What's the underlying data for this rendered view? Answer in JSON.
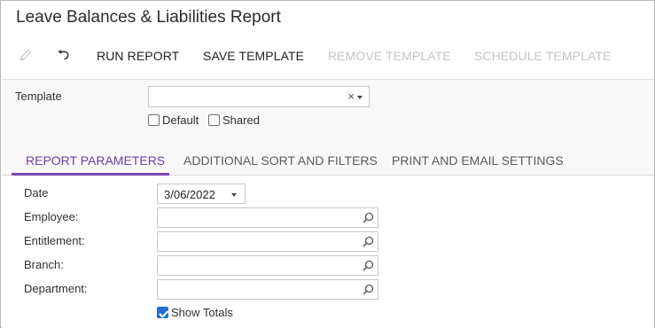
{
  "page": {
    "title": "Leave Balances & Liabilities Report"
  },
  "toolbar": {
    "edit_icon": "pencil-icon",
    "undo_icon": "undo-icon",
    "run_report": "RUN REPORT",
    "save_template": "SAVE TEMPLATE",
    "remove_template": "REMOVE TEMPLATE",
    "schedule_template": "SCHEDULE TEMPLATE"
  },
  "template": {
    "label": "Template",
    "value": "",
    "clear_glyph": "×",
    "default_label": "Default",
    "default_checked": false,
    "shared_label": "Shared",
    "shared_checked": false
  },
  "tabs": [
    {
      "label": "REPORT PARAMETERS",
      "active": true
    },
    {
      "label": "ADDITIONAL SORT AND FILTERS",
      "active": false
    },
    {
      "label": "PRINT AND EMAIL SETTINGS",
      "active": false
    }
  ],
  "parameters": {
    "date_label": "Date",
    "date_value": "3/06/2022",
    "employee_label": "Employee:",
    "employee_value": "",
    "entitlement_label": "Entitlement:",
    "entitlement_value": "",
    "branch_label": "Branch:",
    "branch_value": "",
    "department_label": "Department:",
    "department_value": "",
    "show_totals_label": "Show Totals",
    "show_totals_checked": true
  },
  "colors": {
    "accent": "#7a4bb8",
    "active_tab_text": "#6d3fa6",
    "checkbox_checked": "#1f6fd1",
    "disabled_text": "#c4c4c4"
  }
}
